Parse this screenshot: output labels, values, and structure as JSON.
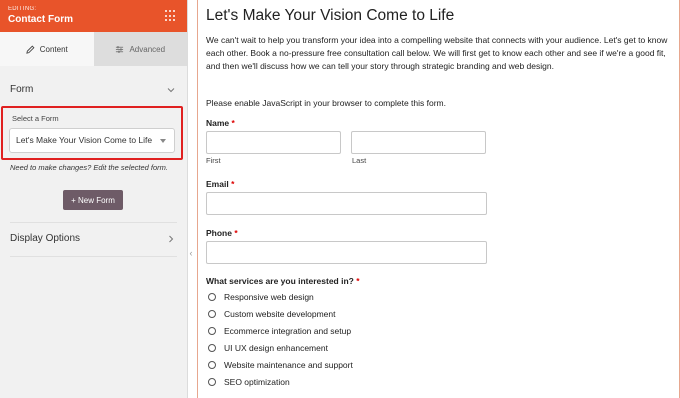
{
  "panel": {
    "editing_label": "EDITING:",
    "title": "Contact Form",
    "tabs": [
      {
        "label": "Content",
        "icon": "pencil-icon",
        "active": true
      },
      {
        "label": "Advanced",
        "icon": "sliders-icon",
        "active": false
      }
    ],
    "form_section": "Form",
    "select_label": "Select a Form",
    "select_value": "Let's Make Your Vision Come to Life",
    "hint": "Need to make changes? Edit the selected form.",
    "new_form_button": "+ New Form",
    "display_options": "Display Options"
  },
  "form": {
    "title": "Let's Make Your Vision Come to Life",
    "intro": "We can't wait to help you transform your idea into a compelling website that connects with your audience. Let's get to know each other. Book a no-pressure free consultation call below. We will first get to know each other and see if we're a good fit, and then we'll discuss how we can tell your story through strategic branding and web design.",
    "js_note": "Please enable JavaScript in your browser to complete this form.",
    "name_label": "Name",
    "first_label": "First",
    "last_label": "Last",
    "email_label": "Email",
    "phone_label": "Phone",
    "services_label": "What services are you interested in?",
    "required_mark": "*",
    "services": [
      "Responsive web design",
      "Custom website development",
      "Ecommerce integration and setup",
      "UI UX design enhancement",
      "Website maintenance and support",
      "SEO optimization"
    ]
  },
  "colors": {
    "header": "#e8542a",
    "highlight": "#e02020",
    "button": "#6e5b67",
    "required": "#dd0000"
  }
}
